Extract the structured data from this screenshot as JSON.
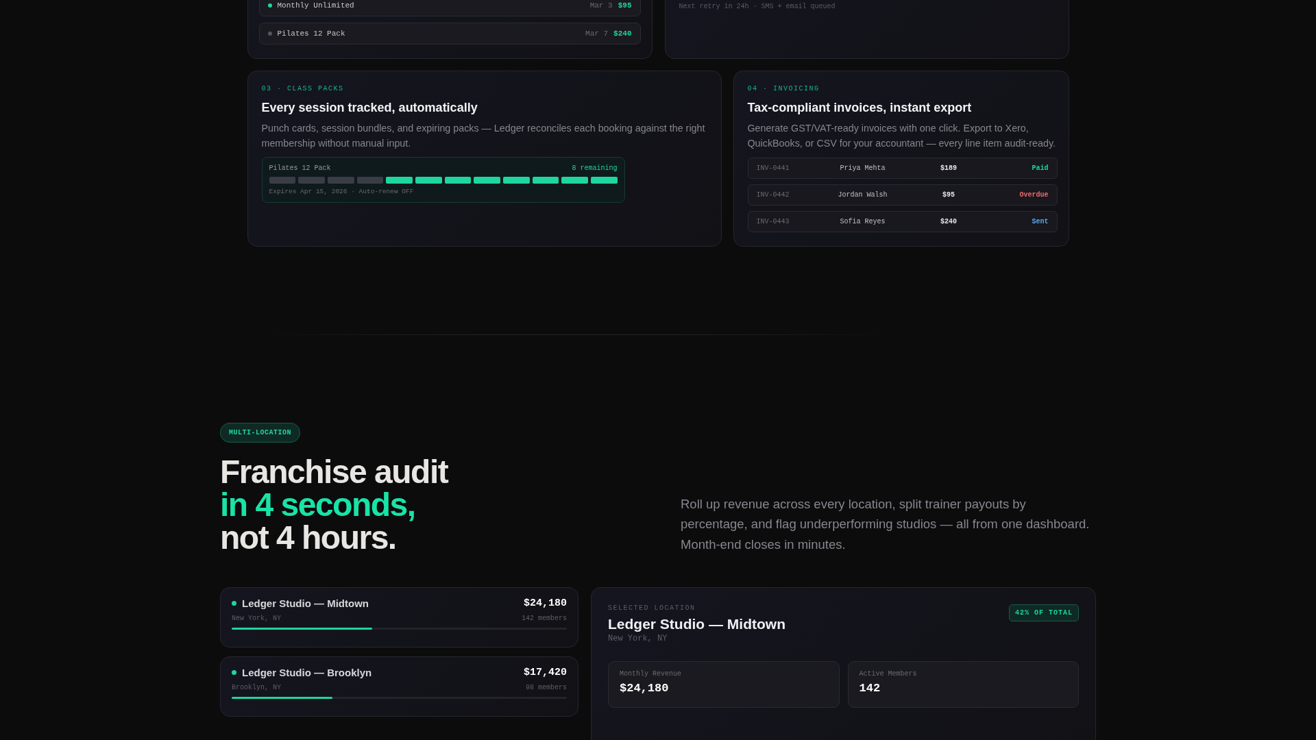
{
  "top_cards": {
    "payments": {
      "rows": [
        {
          "name": "Monthly Unlimited",
          "active": true,
          "date": "Mar 3",
          "amount": "$95"
        },
        {
          "name": "Pilates 12 Pack",
          "active": false,
          "date": "Mar 7",
          "amount": "$240"
        }
      ]
    },
    "retry": {
      "note": "Next retry in 24h · SMS + email queued"
    }
  },
  "class_packs": {
    "label": "03 · CLASS PACKS",
    "title": "Every session tracked, automatically",
    "description": "Punch cards, session bundles, and expiring packs — Ledger reconciles each booking against the right membership without manual input.",
    "pack": {
      "name": "Pilates 12 Pack",
      "remaining_label": "8 remaining",
      "footnote": "Expires Apr 15, 2026 · Auto-renew OFF",
      "sessions": [
        {
          "remaining": false
        },
        {
          "remaining": false
        },
        {
          "remaining": false
        },
        {
          "remaining": false
        },
        {
          "remaining": true
        },
        {
          "remaining": true
        },
        {
          "remaining": true
        },
        {
          "remaining": true
        },
        {
          "remaining": true
        },
        {
          "remaining": true
        },
        {
          "remaining": true
        },
        {
          "remaining": true
        }
      ]
    }
  },
  "invoicing": {
    "label": "04 · INVOICING",
    "title": "Tax-compliant invoices, instant export",
    "description": "Generate GST/VAT-ready invoices with one click. Export to Xero, QuickBooks, or CSV for your accountant — every line item audit-ready.",
    "invoices": [
      {
        "id": "INV-0441",
        "client": "Priya Mehta",
        "amount": "$189",
        "status": "Paid",
        "color": "#1ed6a0"
      },
      {
        "id": "INV-0442",
        "client": "Jordan Walsh",
        "amount": "$95",
        "status": "Overdue",
        "color": "#f06a6a"
      },
      {
        "id": "INV-0443",
        "client": "Sofia Reyes",
        "amount": "$240",
        "status": "Sent",
        "color": "#5aa8f0"
      }
    ]
  },
  "multi_location": {
    "badge": "MULTI-LOCATION",
    "headline": [
      {
        "text": "Franchise audit",
        "highlight": false
      },
      {
        "text": "in 4 seconds,",
        "highlight": true
      },
      {
        "text": "not 4 hours.",
        "highlight": false
      }
    ],
    "description": "Roll up revenue across every location, split trainer payouts by percentage, and flag underperforming studios — all from one dashboard. Month-end closes in minutes.",
    "locations": [
      {
        "name": "Ledger Studio — Midtown",
        "revenue": "$24,180",
        "city": "New York, NY",
        "members": "142 members",
        "level": 0.42,
        "color": "#1ed6a0"
      },
      {
        "name": "Ledger Studio — Brooklyn",
        "revenue": "$17,420",
        "city": "Brooklyn, NY",
        "members": "98 members",
        "level": 0.3,
        "color": "#1ed6a0"
      }
    ],
    "selected": {
      "label": "SELECTED LOCATION",
      "name": "Ledger Studio — Midtown",
      "city": "New York, NY",
      "share": "42% OF TOTAL",
      "stats": [
        {
          "label": "Monthly Revenue",
          "value": "$24,180"
        },
        {
          "label": "Active Members",
          "value": "142"
        }
      ]
    }
  }
}
